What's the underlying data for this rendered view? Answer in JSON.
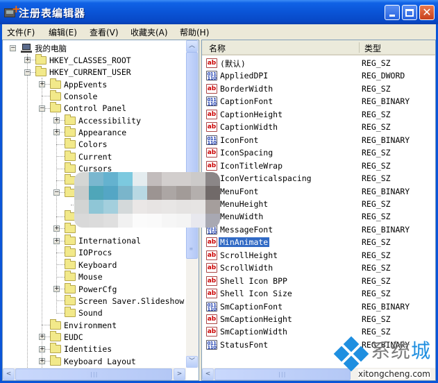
{
  "window": {
    "title": "注册表编辑器",
    "app_icon": "regedit-icon",
    "controls": [
      "minimize-icon",
      "maximize-icon",
      "close-icon"
    ]
  },
  "menubar": {
    "items": [
      {
        "label": "文件(F)"
      },
      {
        "label": "编辑(E)"
      },
      {
        "label": "查看(V)"
      },
      {
        "label": "收藏夹(A)"
      },
      {
        "label": "帮助(H)"
      }
    ]
  },
  "tree": {
    "root": {
      "label": "我的电脑",
      "icon": "computer-icon",
      "state": "expanded"
    },
    "nodes": [
      {
        "label": "HKEY_CLASSES_ROOT",
        "level": 1,
        "state": "collapsed"
      },
      {
        "label": "HKEY_CURRENT_USER",
        "level": 1,
        "state": "expanded"
      },
      {
        "label": "AppEvents",
        "level": 2,
        "state": "collapsed"
      },
      {
        "label": "Console",
        "level": 2,
        "state": "leaf"
      },
      {
        "label": "Control Panel",
        "level": 2,
        "state": "expanded"
      },
      {
        "label": "Accessibility",
        "level": 3,
        "state": "collapsed"
      },
      {
        "label": "Appearance",
        "level": 3,
        "state": "collapsed"
      },
      {
        "label": "Colors",
        "level": 3,
        "state": "leaf"
      },
      {
        "label": "Current",
        "level": 3,
        "state": "leaf"
      },
      {
        "label": "Cursors",
        "level": 3,
        "state": "leaf"
      },
      {
        "label": "",
        "level": 3,
        "state": "leaf",
        "obscured": true
      },
      {
        "label": "",
        "level": 3,
        "state": "expanded",
        "obscured": true
      },
      {
        "label": "",
        "level": 4,
        "state": "leaf",
        "obscured": true
      },
      {
        "label": "",
        "level": 3,
        "state": "leaf",
        "obscured": true
      },
      {
        "label": "",
        "level": 3,
        "state": "collapsed",
        "obscured": true
      },
      {
        "label": "International",
        "level": 3,
        "state": "collapsed"
      },
      {
        "label": "IOProcs",
        "level": 3,
        "state": "leaf"
      },
      {
        "label": "Keyboard",
        "level": 3,
        "state": "leaf"
      },
      {
        "label": "Mouse",
        "level": 3,
        "state": "leaf"
      },
      {
        "label": "PowerCfg",
        "level": 3,
        "state": "collapsed"
      },
      {
        "label": "Screen Saver.Slideshow",
        "level": 3,
        "state": "leaf"
      },
      {
        "label": "Sound",
        "level": 3,
        "state": "leaf"
      },
      {
        "label": "Environment",
        "level": 2,
        "state": "leaf"
      },
      {
        "label": "EUDC",
        "level": 2,
        "state": "collapsed"
      },
      {
        "label": "Identities",
        "level": 2,
        "state": "collapsed"
      },
      {
        "label": "Keyboard Layout",
        "level": 2,
        "state": "collapsed"
      }
    ]
  },
  "values": {
    "columns": {
      "name": "名称",
      "type": "类型"
    },
    "selected": "MinAnimate",
    "rows": [
      {
        "name": "(默认)",
        "type": "REG_SZ",
        "icon": "string-value-icon"
      },
      {
        "name": "AppliedDPI",
        "type": "REG_DWORD",
        "icon": "binary-value-icon"
      },
      {
        "name": "BorderWidth",
        "type": "REG_SZ",
        "icon": "string-value-icon"
      },
      {
        "name": "CaptionFont",
        "type": "REG_BINARY",
        "icon": "binary-value-icon"
      },
      {
        "name": "CaptionHeight",
        "type": "REG_SZ",
        "icon": "string-value-icon"
      },
      {
        "name": "CaptionWidth",
        "type": "REG_SZ",
        "icon": "string-value-icon"
      },
      {
        "name": "IconFont",
        "type": "REG_BINARY",
        "icon": "binary-value-icon"
      },
      {
        "name": "IconSpacing",
        "type": "REG_SZ",
        "icon": "string-value-icon"
      },
      {
        "name": "IconTitleWrap",
        "type": "REG_SZ",
        "icon": "string-value-icon"
      },
      {
        "name": "IconVerticalspacing",
        "type": "REG_SZ",
        "icon": "string-value-icon"
      },
      {
        "name": "MenuFont",
        "type": "REG_BINARY",
        "icon": "binary-value-icon"
      },
      {
        "name": "MenuHeight",
        "type": "REG_SZ",
        "icon": "string-value-icon"
      },
      {
        "name": "MenuWidth",
        "type": "REG_SZ",
        "icon": "string-value-icon"
      },
      {
        "name": "MessageFont",
        "type": "REG_BINARY",
        "icon": "binary-value-icon"
      },
      {
        "name": "MinAnimate",
        "type": "REG_SZ",
        "icon": "string-value-icon"
      },
      {
        "name": "ScrollHeight",
        "type": "REG_SZ",
        "icon": "string-value-icon"
      },
      {
        "name": "ScrollWidth",
        "type": "REG_SZ",
        "icon": "string-value-icon"
      },
      {
        "name": "Shell Icon BPP",
        "type": "REG_SZ",
        "icon": "string-value-icon"
      },
      {
        "name": "Shell Icon Size",
        "type": "REG_SZ",
        "icon": "string-value-icon"
      },
      {
        "name": "SmCaptionFont",
        "type": "REG_BINARY",
        "icon": "binary-value-icon"
      },
      {
        "name": "SmCaptionHeight",
        "type": "REG_SZ",
        "icon": "string-value-icon"
      },
      {
        "name": "SmCaptionWidth",
        "type": "REG_SZ",
        "icon": "string-value-icon"
      },
      {
        "name": "StatusFont",
        "type": "REG_BINARY",
        "icon": "binary-value-icon"
      }
    ]
  },
  "scrollbars": {
    "tree_vertical_position": 0.0,
    "tree_vertical_visible_fraction": 0.68
  },
  "watermark": {
    "brand_cn_gray": "系统",
    "brand_cn_blue": "城",
    "url": "xitongcheng.com"
  },
  "colors": {
    "titlebar": "#0a54d6",
    "selection": "#316ac5",
    "menubar": "#ece9d8",
    "watermark_blue": "#1f8fe0"
  },
  "mosaic_colors": [
    "#d4d6d4",
    "#7ab7cf",
    "#64b2cf",
    "#7cc9df",
    "#e4ecef",
    "#c2bcbc",
    "#d2cecd",
    "#d2cecd",
    "#cccac9",
    "#8b8687",
    "#c8cccb",
    "#4fa6b9",
    "#54a6c5",
    "#7ab5cb",
    "#b8d8e3",
    "#9c9492",
    "#aca6a4",
    "#a29b98",
    "#b4afad",
    "#716a69",
    "#d2d4d3",
    "#8fc6d6",
    "#a3cfdd",
    "#d4d9da",
    "#eae7e6",
    "#e7e4e3",
    "#e8e6e5",
    "#e5e3e2",
    "#e6e4e3",
    "#a59e9c",
    "#d9d9d9",
    "#dbdbdb",
    "#dfdfdf",
    "#f1f1f1",
    "#fbfbfb",
    "#fafafa",
    "#f6f6f6",
    "#f4f4f4",
    "#e8e8ee",
    "#a8a8b2"
  ]
}
